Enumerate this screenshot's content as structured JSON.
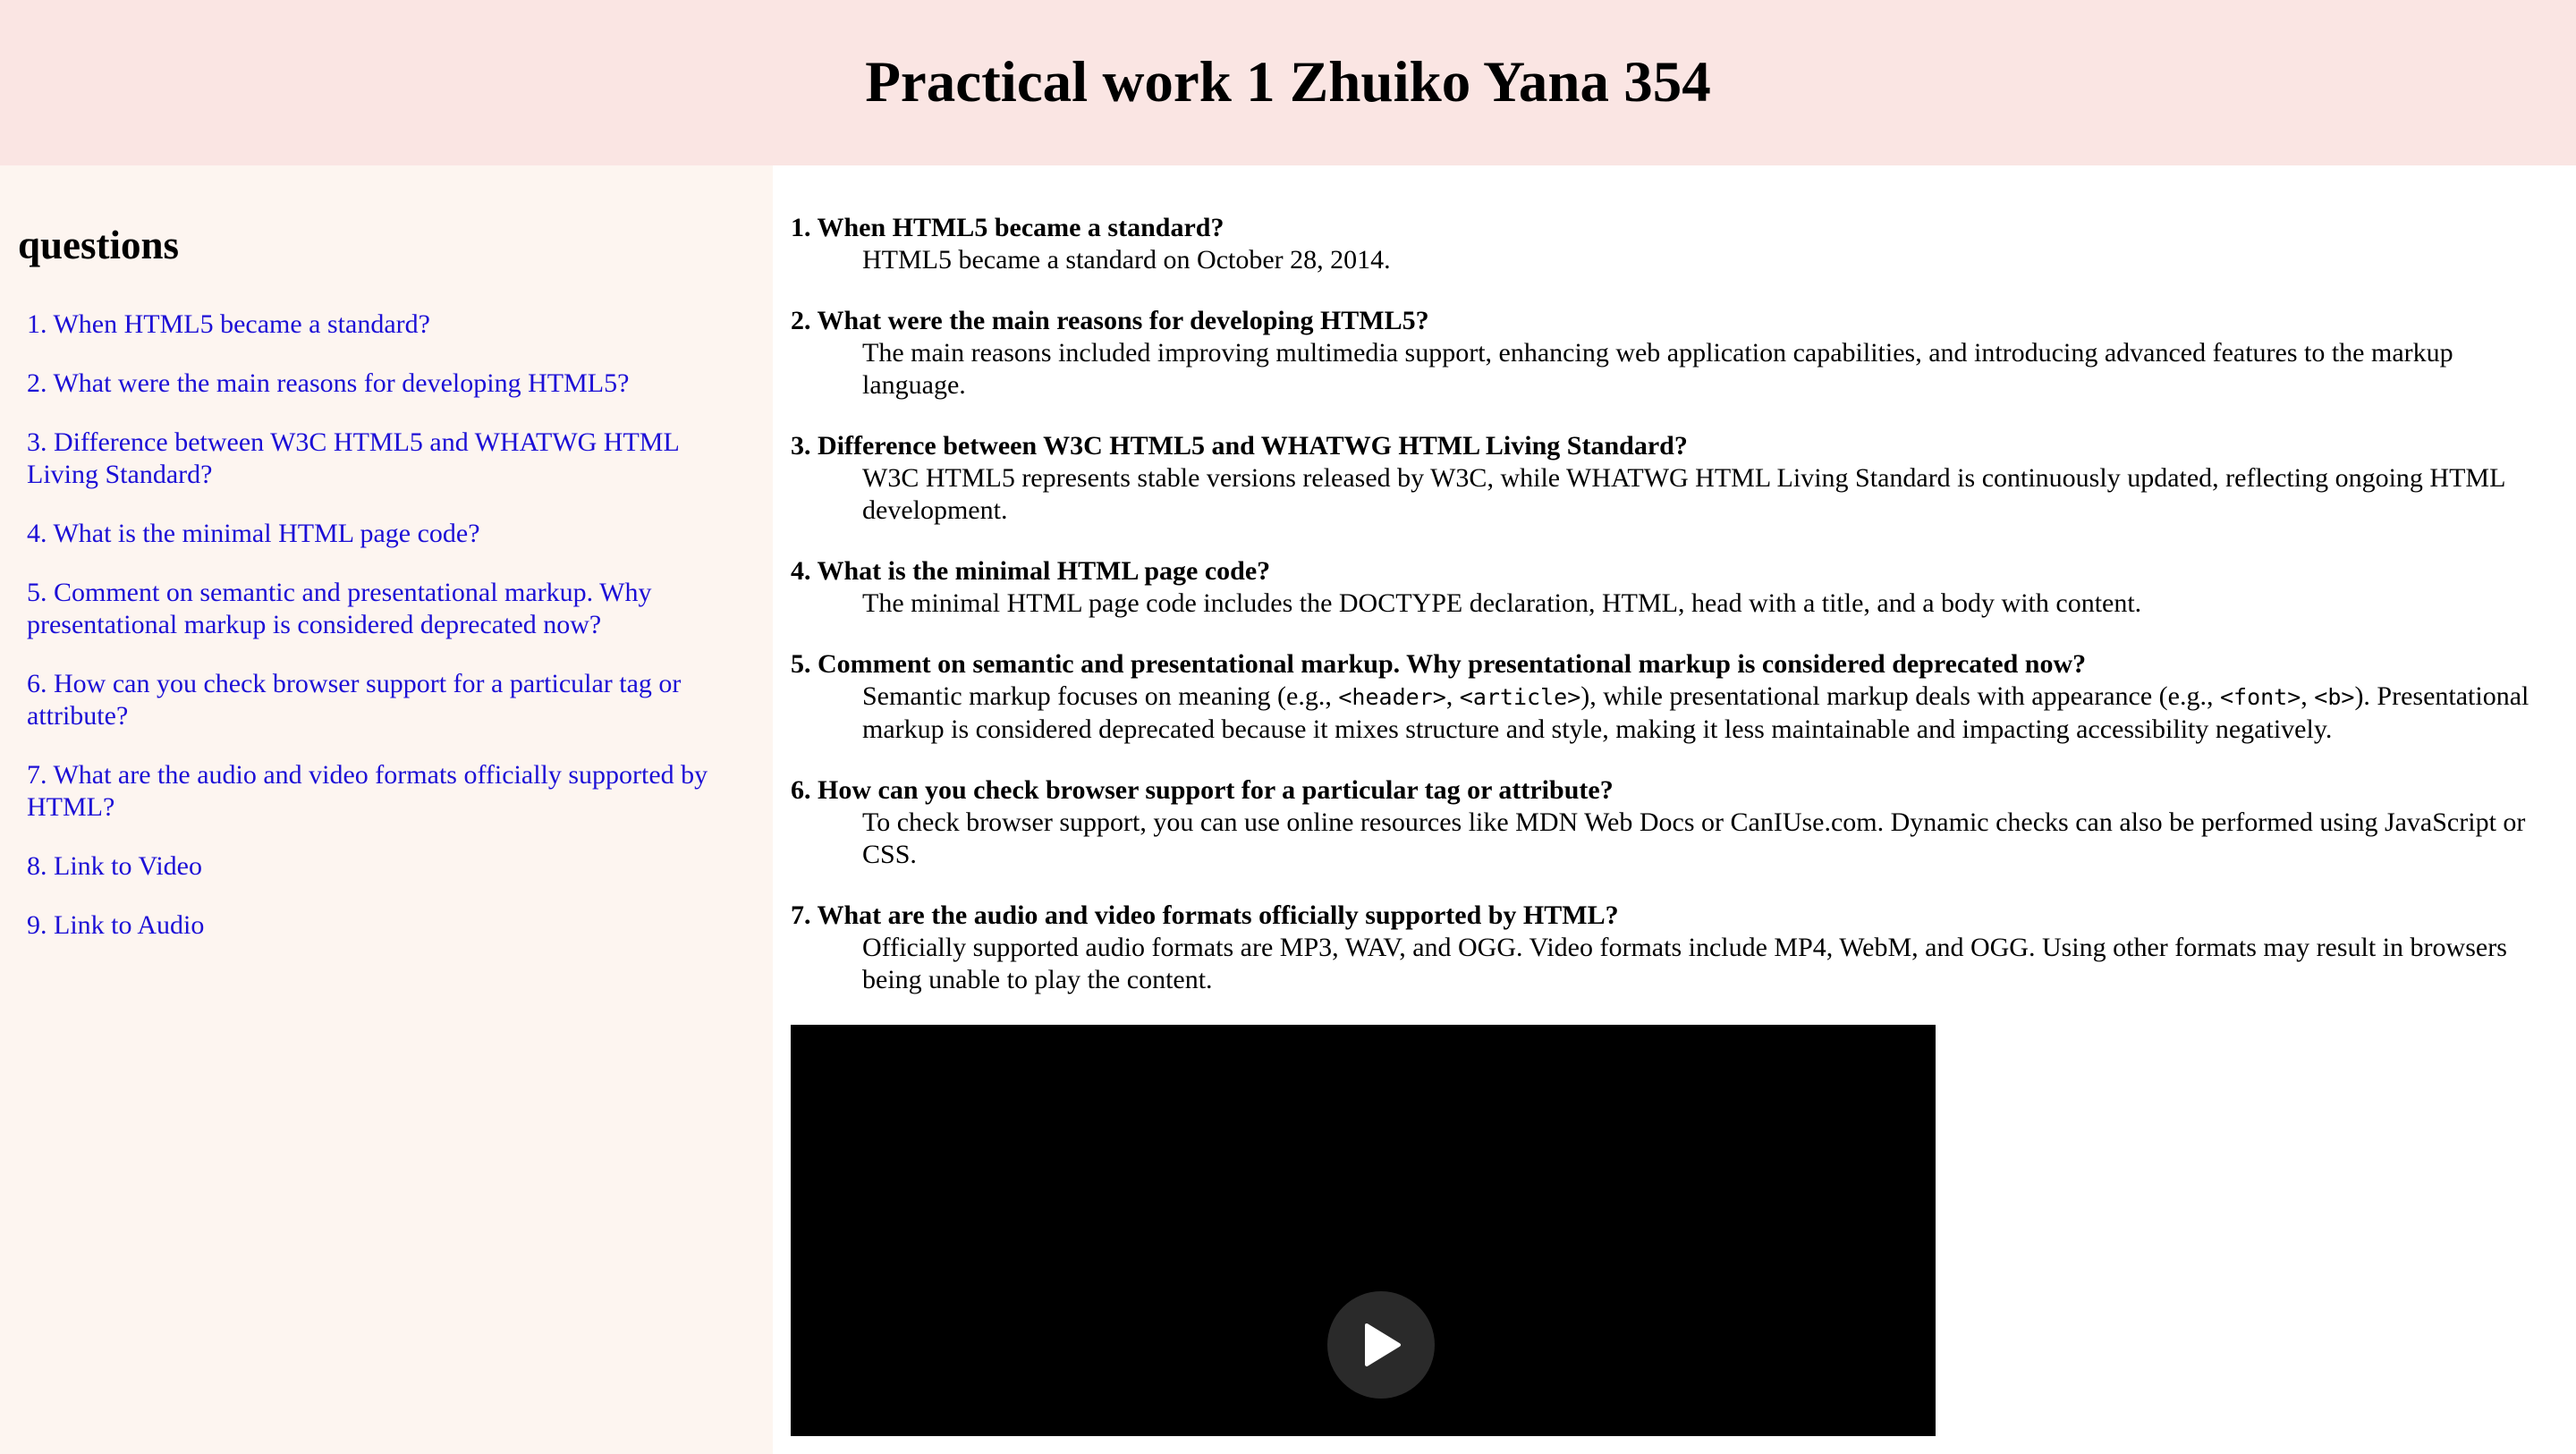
{
  "header": {
    "title": "Practical work 1 Zhuiko Yana 354"
  },
  "sidebar": {
    "heading": "questions",
    "links": [
      "1. When HTML5 became a standard?",
      "2. What were the main reasons for developing HTML5?",
      "3. Difference between W3C HTML5 and WHATWG HTML Living Standard?",
      "4. What is the minimal HTML page code?",
      "5. Comment on semantic and presentational markup. Why presentational markup is considered deprecated now?",
      "6. How can you check browser support for a particular tag or attribute?",
      "7. What are the audio and video formats officially supported by HTML?",
      "8. Link to Video",
      "9. Link to Audio"
    ]
  },
  "main": {
    "qa": [
      {
        "q": "1. When HTML5 became a standard?",
        "a": "HTML5 became a standard on October 28, 2014."
      },
      {
        "q": "2. What were the main reasons for developing HTML5?",
        "a": "The main reasons included improving multimedia support, enhancing web application capabilities, and introducing advanced features to the markup language."
      },
      {
        "q": "3. Difference between W3C HTML5 and WHATWG HTML Living Standard?",
        "a": "W3C HTML5 represents stable versions released by W3C, while WHATWG HTML Living Standard is continuously updated, reflecting ongoing HTML development."
      },
      {
        "q": "4. What is the minimal HTML page code?",
        "a": "The minimal HTML page code includes the DOCTYPE declaration, HTML, head with a title, and a body with content."
      },
      {
        "q": "5. Comment on semantic and presentational markup. Why presentational markup is considered deprecated now?",
        "a_parts": [
          "Semantic markup focuses on meaning (e.g., ",
          "<header>",
          ", ",
          "<article>",
          "), while presentational markup deals with appearance (e.g., ",
          "<font>",
          ", ",
          "<b>",
          "). Presentational markup is considered deprecated because it mixes structure and style, making it less maintainable and impacting accessibility negatively."
        ]
      },
      {
        "q": "6. How can you check browser support for a particular tag or attribute?",
        "a": "To check browser support, you can use online resources like MDN Web Docs or CanIUse.com. Dynamic checks can also be performed using JavaScript or CSS."
      },
      {
        "q": "7. What are the audio and video formats officially supported by HTML?",
        "a": "Officially supported audio formats are MP3, WAV, and OGG. Video formats include MP4, WebM, and OGG. Using other formats may result in browsers being unable to play the content."
      }
    ],
    "video": {
      "play_icon": "play-icon"
    }
  },
  "colors": {
    "header_bg": "#fae5e3",
    "sidebar_bg": "#fdf5f0",
    "link": "#1c0fd6"
  }
}
